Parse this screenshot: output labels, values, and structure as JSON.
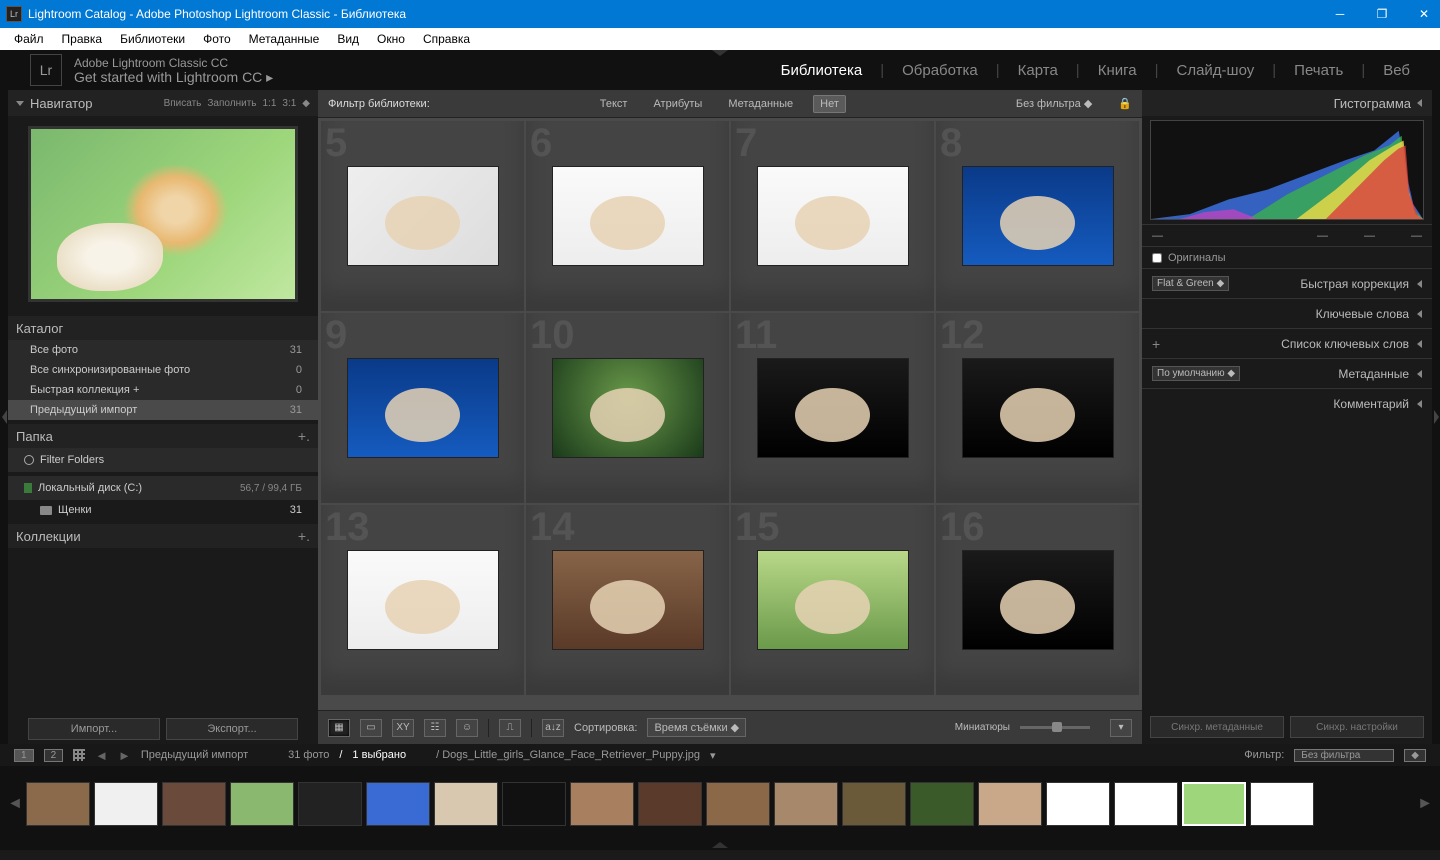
{
  "titlebar": {
    "app_icon": "Lr",
    "title": "Lightroom Catalog - Adobe Photoshop Lightroom Classic - Библиотека"
  },
  "menubar": [
    "Файл",
    "Правка",
    "Библиотеки",
    "Фото",
    "Метаданные",
    "Вид",
    "Окно",
    "Справка"
  ],
  "brand": {
    "line1": "Adobe Lightroom Classic CC",
    "line2": "Get started with Lightroom CC ▸"
  },
  "modules": [
    "Библиотека",
    "Обработка",
    "Карта",
    "Книга",
    "Слайд-шоу",
    "Печать",
    "Веб"
  ],
  "active_module": "Библиотека",
  "navigator": {
    "title": "Навигатор",
    "opts": [
      "Вписать",
      "Заполнить",
      "1:1",
      "3:1"
    ]
  },
  "catalog": {
    "title": "Каталог",
    "items": [
      {
        "label": "Все фото",
        "count": 31
      },
      {
        "label": "Все синхронизированные фото",
        "count": 0
      },
      {
        "label": "Быстрая коллекция  +",
        "count": 0
      },
      {
        "label": "Предыдущий импорт",
        "count": 31,
        "selected": true
      }
    ]
  },
  "folders": {
    "title": "Папка",
    "filter_label": "Filter Folders",
    "disk": "Локальный диск (C:)",
    "disk_stat": "56,7 / 99,4 ГБ",
    "children": [
      {
        "label": "Щенки",
        "count": 31
      }
    ]
  },
  "collections": {
    "title": "Коллекции"
  },
  "left_buttons": {
    "import": "Импорт...",
    "export": "Экспорт..."
  },
  "filter_bar": {
    "title": "Фильтр библиотеки:",
    "tabs": [
      "Текст",
      "Атрибуты",
      "Метаданные",
      "Нет"
    ],
    "active": "Нет",
    "preset": "Без фильтра"
  },
  "grid_start": 5,
  "toolbar": {
    "sort_label": "Сортировка:",
    "sort_value": "Время съёмки",
    "thumbs": "Миниатюры"
  },
  "right": {
    "histogram": "Гистограмма",
    "originals": "Оригиналы",
    "preset": "Flat & Green",
    "quick": "Быстрая коррекция",
    "keywords": "Ключевые слова",
    "keyword_list": "Список ключевых слов",
    "meta_preset": "По умолчанию",
    "metadata": "Метаданные",
    "comments": "Комментарий",
    "btn1": "Синхр. метаданные",
    "btn2": "Синхр. настройки"
  },
  "status": {
    "breadcrumb": "Предыдущий импорт",
    "total": "31 фото",
    "selected": "1 выбрано",
    "path": "/ Dogs_Little_girls_Glance_Face_Retriever_Puppy.jpg",
    "filter_label": "Фильтр:",
    "filter_value": "Без фильтра"
  }
}
